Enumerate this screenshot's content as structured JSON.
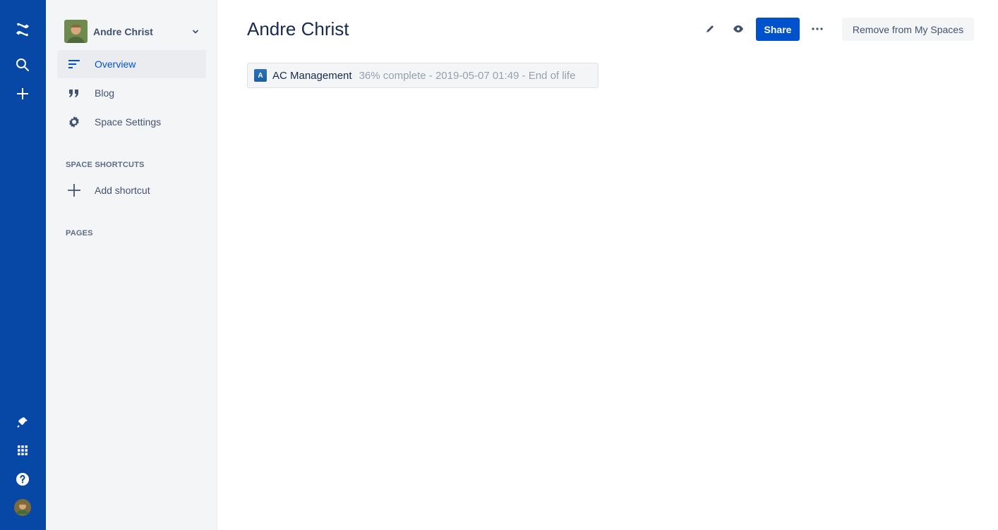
{
  "global_nav": {
    "icons": [
      "confluence-logo-icon",
      "search-icon",
      "create-icon",
      "notifications-icon",
      "app-switcher-icon",
      "help-icon",
      "profile-avatar-icon"
    ]
  },
  "sidebar": {
    "space_name": "Andre Christ",
    "items": [
      {
        "label": "Overview",
        "icon": "overview-icon",
        "active": true
      },
      {
        "label": "Blog",
        "icon": "quote-icon",
        "active": false
      },
      {
        "label": "Space Settings",
        "icon": "gear-icon",
        "active": false
      }
    ],
    "shortcuts_heading": "SPACE SHORTCUTS",
    "add_shortcut_label": "Add shortcut",
    "pages_heading": "PAGES"
  },
  "header": {
    "title": "Andre Christ",
    "share_label": "Share",
    "remove_label": "Remove from My Spaces",
    "icons": [
      "edit-icon",
      "watch-icon",
      "more-icon"
    ]
  },
  "status_lozenge": {
    "badge_letter": "A",
    "name": "AC Management",
    "meta": "36% complete - 2019-05-07 01:49 - End of life"
  },
  "colors": {
    "nav_bg": "#0747a6",
    "primary": "#0052cc",
    "sidebar_bg": "#f4f5f7"
  }
}
